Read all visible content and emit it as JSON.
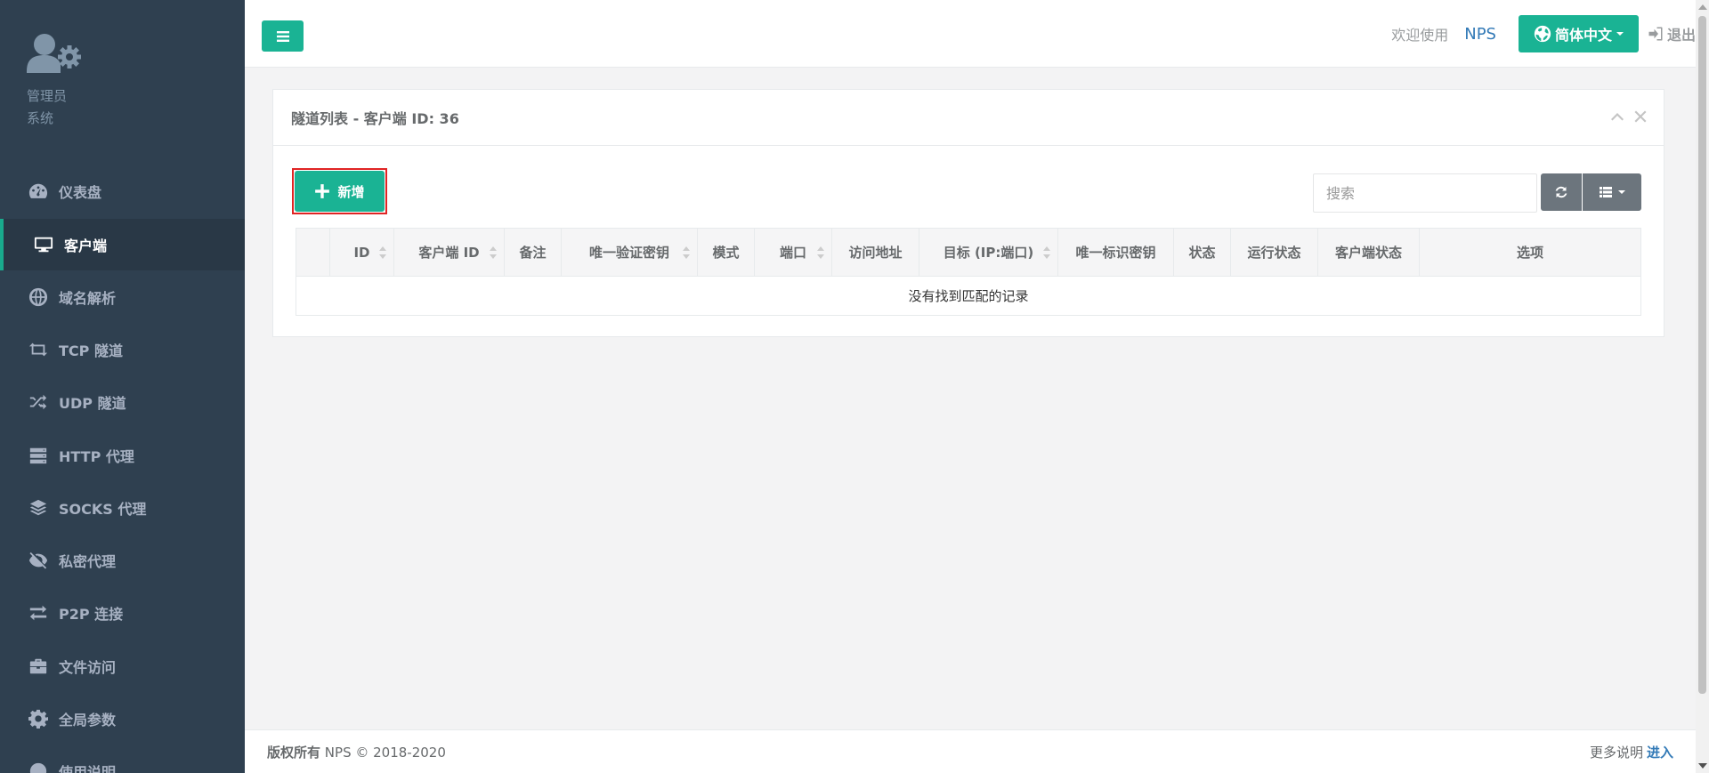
{
  "sidebar": {
    "profile": {
      "role": "管理员",
      "system": "系统"
    },
    "items": [
      {
        "label": "仪表盘",
        "icon": "dashboard-icon"
      },
      {
        "label": "客户端",
        "icon": "desktop-icon",
        "active": true
      },
      {
        "label": "域名解析",
        "icon": "globe-icon"
      },
      {
        "label": "TCP 隧道",
        "icon": "retweet-icon"
      },
      {
        "label": "UDP 隧道",
        "icon": "random-icon"
      },
      {
        "label": "HTTP 代理",
        "icon": "server-icon"
      },
      {
        "label": "SOCKS 代理",
        "icon": "layers-icon"
      },
      {
        "label": "私密代理",
        "icon": "eye-slash-icon"
      },
      {
        "label": "P2P 连接",
        "icon": "exchange-icon"
      },
      {
        "label": "文件访问",
        "icon": "briefcase-icon"
      },
      {
        "label": "全局参数",
        "icon": "gear-icon"
      },
      {
        "label": "使用说明",
        "icon": "info-icon"
      }
    ]
  },
  "header": {
    "welcome": "欢迎使用",
    "brand": "NPS",
    "language": "简体中文",
    "logout": "退出"
  },
  "panel": {
    "title": "隧道列表 - 客户端 ID: 36",
    "add_label": "新增",
    "search_placeholder": "搜索",
    "columns": [
      "ID",
      "客户端 ID",
      "备注",
      "唯一验证密钥",
      "模式",
      "端口",
      "访问地址",
      "目标 (IP:端口)",
      "唯一标识密钥",
      "状态",
      "运行状态",
      "客户端状态",
      "选项"
    ],
    "empty_message": "没有找到匹配的记录"
  },
  "footer": {
    "copyright_label": "版权所有",
    "copyright_text": "NPS © 2018-2020",
    "more_label": "更多说明",
    "enter_link": "进入"
  },
  "colors": {
    "accent": "#1ab394",
    "sidebar_bg": "#2f4050",
    "highlight_border": "#e02424"
  }
}
